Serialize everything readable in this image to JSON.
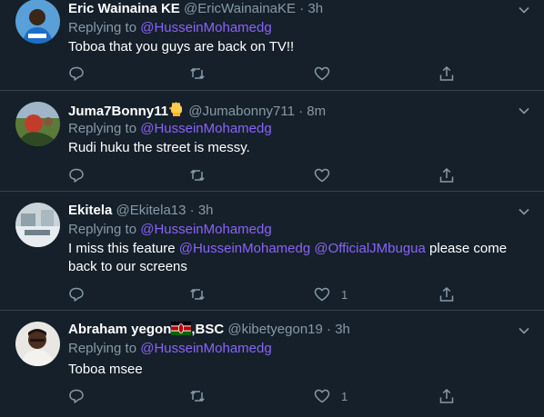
{
  "replying_prefix": "Replying to",
  "tweets": [
    {
      "name": "Eric Wainaina KE",
      "handle": "@EricWainainaKE",
      "separator": "·",
      "time": "3h",
      "replying_to": "@HusseinMohamedg",
      "text": "Toboa that you guys are back on TV!!",
      "likes": "",
      "avatar_colors": {
        "bg": "#5aa0d8",
        "skin": "#3b2618",
        "shirt": "#1c6fc4"
      }
    },
    {
      "name": "Juma7Bonny11",
      "name_emoji": "raised-fist-emoji",
      "handle": "@Jumabonny711",
      "separator": "·",
      "time": "8m",
      "replying_to": "@HusseinMohamedg",
      "text": "Rudi huku the street is messy.",
      "likes": "",
      "avatar_colors": {
        "bg": "#5b7a3a",
        "skin": "#c23c2c",
        "shirt": "#2f4a22"
      }
    },
    {
      "name": "Ekitela",
      "handle": "@Ekitela13",
      "separator": "·",
      "time": "3h",
      "replying_to": "@HusseinMohamedg",
      "text_parts": [
        {
          "t": "I miss this feature ",
          "mention": false
        },
        {
          "t": "@HusseinMohamedg",
          "mention": true
        },
        {
          "t": " ",
          "mention": false
        },
        {
          "t": "@OfficialJMbugua",
          "mention": true
        },
        {
          "t": " please come back to our screens",
          "mention": false
        }
      ],
      "likes": "1",
      "avatar_colors": {
        "bg": "#c9d3d8",
        "skin": "#8fa1ab",
        "shirt": "#e6ecef"
      }
    },
    {
      "name": "Abraham yegon",
      "name_emoji": "kenya-flag-emoji",
      "name_suffix": ",BSC",
      "handle": "@kibetyegon19",
      "separator": "·",
      "time": "3h",
      "replying_to": "@HusseinMohamedg",
      "text": "Toboa msee",
      "likes": "1",
      "avatar_colors": {
        "bg": "#e9e7e3",
        "skin": "#4a2e1e",
        "shirt": "#f4f2ee"
      }
    }
  ],
  "colors": {
    "background": "#15202b",
    "accent": "#8b63f8",
    "muted": "#8899a6",
    "divider": "#38444d"
  }
}
